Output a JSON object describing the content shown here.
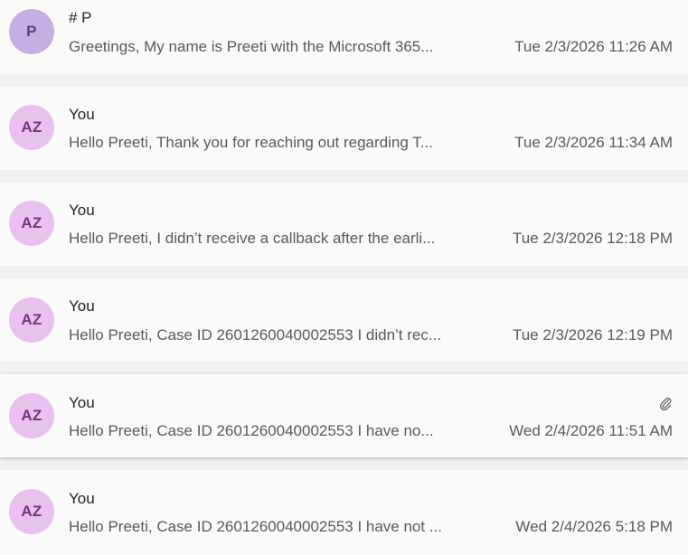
{
  "colors": {
    "avatar_p_bg": "#c6aee0",
    "avatar_p_fg": "#5b3a86",
    "avatar_az_bg": "#e7c2ec",
    "avatar_az_fg": "#7a2f83"
  },
  "messages": [
    {
      "avatar": "P",
      "sender": "# P",
      "preview": "Greetings, My name is Preeti with the Microsoft 365...",
      "timestamp": "Tue 2/3/2026 11:26 AM"
    },
    {
      "avatar": "AZ",
      "sender": "You",
      "preview": "Hello Preeti, Thank you for reaching out regarding T...",
      "timestamp": "Tue 2/3/2026 11:34 AM"
    },
    {
      "avatar": "AZ",
      "sender": "You",
      "preview": "Hello Preeti, I didn’t receive a callback after the earli...",
      "timestamp": "Tue 2/3/2026 12:18 PM"
    },
    {
      "avatar": "AZ",
      "sender": "You",
      "preview": "Hello Preeti, Case ID 2601260040002553 I didn’t rec...",
      "timestamp": "Tue 2/3/2026 12:19 PM"
    },
    {
      "avatar": "AZ",
      "sender": "You",
      "preview": "Hello Preeti, Case ID 2601260040002553 I have no...",
      "timestamp": "Wed 2/4/2026 11:51 AM",
      "attachment_icon": "paperclip-icon"
    },
    {
      "avatar": "AZ",
      "sender": "You",
      "preview": "Hello Preeti, Case ID 2601260040002553 I have not ...",
      "timestamp": "Wed 2/4/2026 5:18 PM"
    }
  ]
}
